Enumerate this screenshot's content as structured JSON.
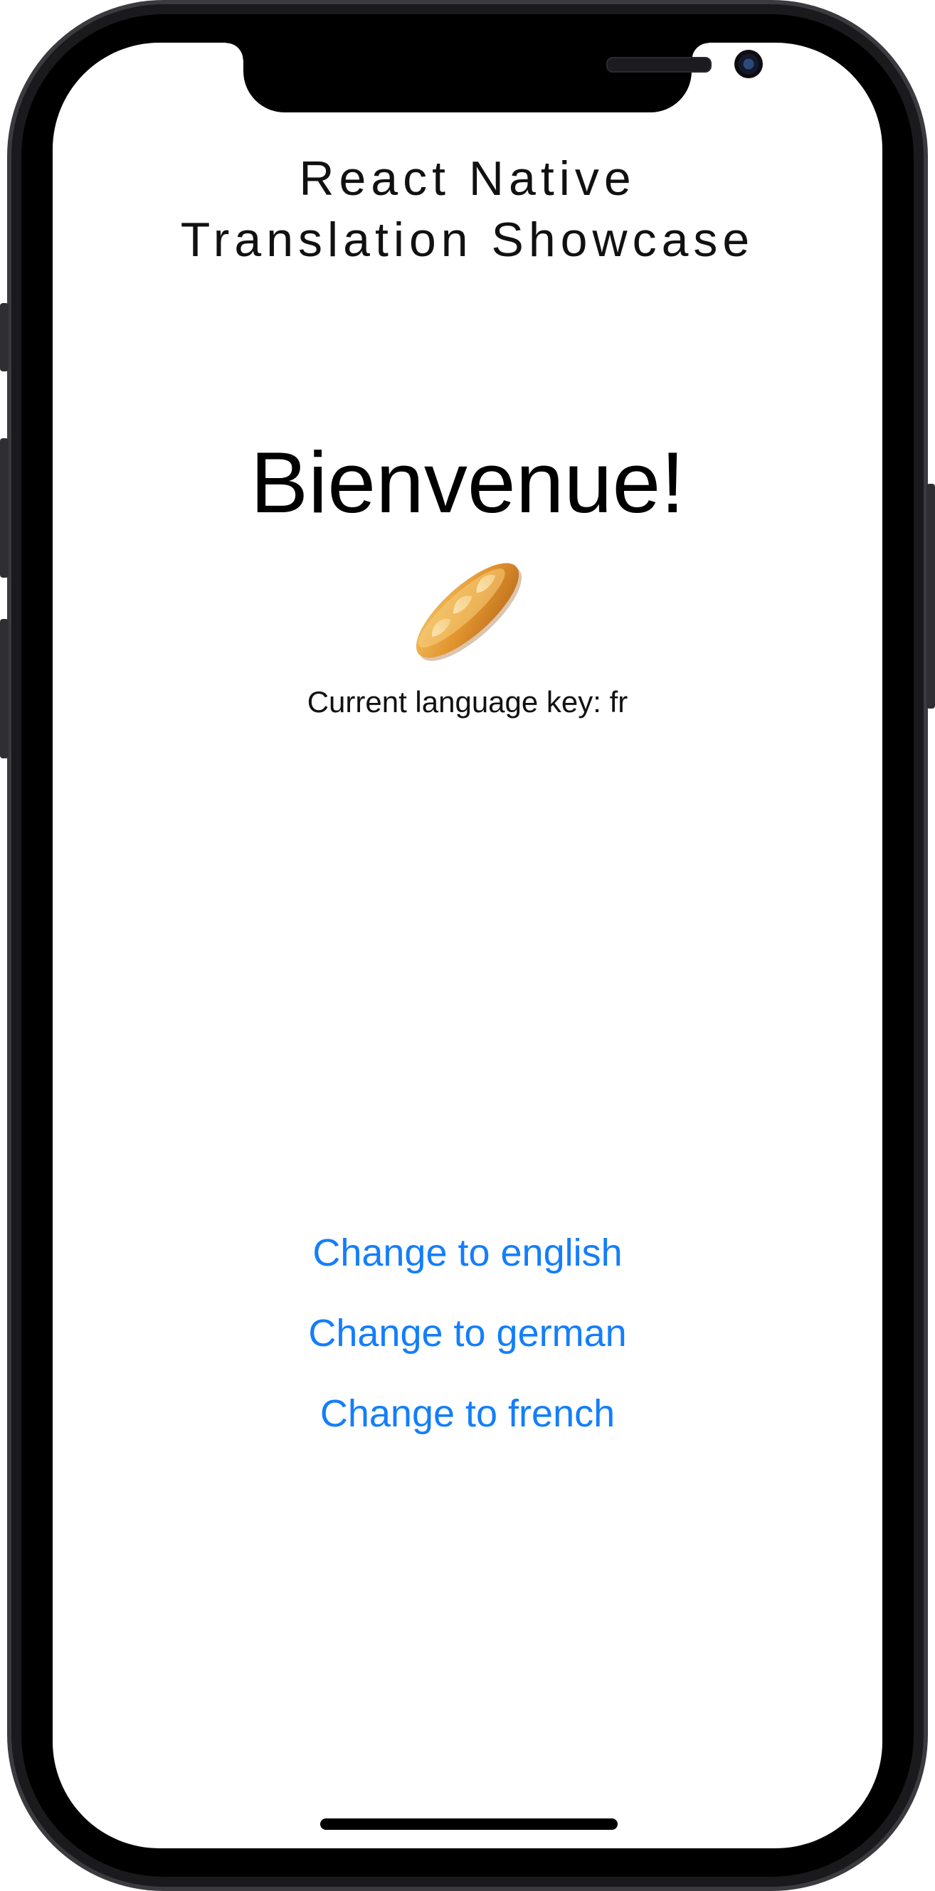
{
  "app": {
    "title": "React Native\nTranslation Showcase"
  },
  "main": {
    "welcome_text": "Bienvenue!",
    "flag_icon": "baguette-icon",
    "current_language_label": "Current language key: fr"
  },
  "actions": [
    {
      "label": "Change to english"
    },
    {
      "label": "Change to german"
    },
    {
      "label": "Change to french"
    }
  ],
  "colors": {
    "accent": "#147efb",
    "text": "#000000",
    "background": "#ffffff"
  }
}
